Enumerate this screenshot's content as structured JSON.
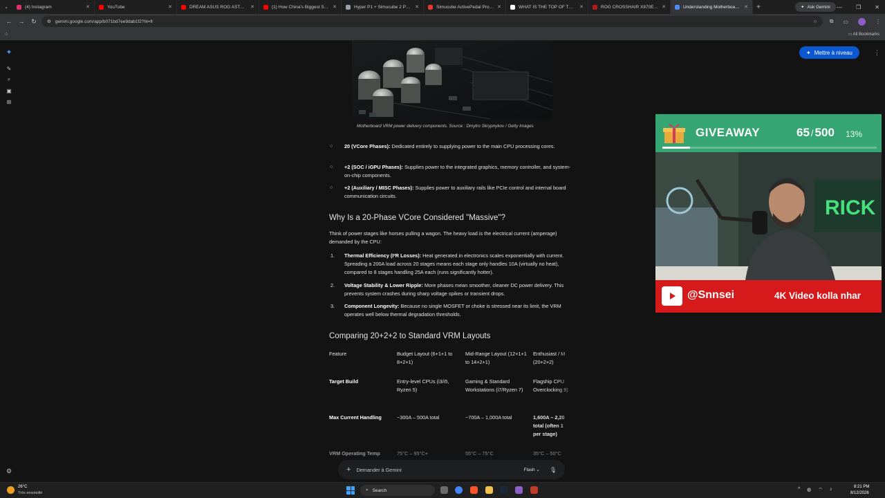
{
  "browser": {
    "tabs": [
      {
        "title": "(4) Instagram",
        "color": "#e1306c"
      },
      {
        "title": "YouTube",
        "color": "#ff0000"
      },
      {
        "title": "DREAM ASUS ROG ASTRAL RTX",
        "color": "#ff0000"
      },
      {
        "title": "(1) How China's Biggest Scam",
        "color": "#ff0000"
      },
      {
        "title": "Hyper P1 + Simucube 2 Pro Bu",
        "color": "#9aa0a6"
      },
      {
        "title": "Simucube ActivePedal Pro - Ad",
        "color": "#e23b2e"
      },
      {
        "title": "WHAT IS THE TOP OF THE LINE",
        "color": "#ffffff"
      },
      {
        "title": "ROG CROSSHAIR X870E GLACI",
        "color": "#b31b1b"
      },
      {
        "title": "Understanding Motherboard P",
        "color": "#4e8df5"
      }
    ],
    "active_tab_index": 8,
    "new_tab_label": "+",
    "ask_gemini": "Ask Gemini",
    "url": "gemini.google.com/app/b071bd7ee9dab1f2?hl=fr",
    "all_bookmarks": "All Bookmarks"
  },
  "gemini": {
    "upgrade_button": "Mettre à niveau",
    "caption": "Motherboard VRM power delivery components. Source : Dmytro Skrypnykov / Getty Images",
    "bullets": [
      {
        "title": "20 (VCore Phases):",
        "text": " Dedicated entirely to supplying power to the main CPU processing cores."
      },
      {
        "title": "+2 (SOC / iGPU Phases):",
        "text": " Supplies power to the integrated graphics, memory controller, and system-on-chip components."
      },
      {
        "title": "+2 (Auxiliary / MISC Phases):",
        "text": " Supplies power to auxiliary rails like PCIe control and internal board communication circuits."
      }
    ],
    "section1_heading": "Why Is a 20-Phase VCore Considered \"Massive\"?",
    "section1_intro": "Think of power stages like horses pulling a wagon. The heavy load is the electrical current (amperage) demanded by the CPU:",
    "numbered": [
      {
        "n": "1.",
        "title": "Thermal Efficiency (I²R Losses):",
        "text": " Heat generated in electronics scales exponentially with current. Spreading a 200A load across 20 stages means each stage only handles 10A (virtually no heat), compared to 8 stages handling 25A each (runs significantly hotter)."
      },
      {
        "n": "2.",
        "title": "Voltage Stability & Lower Ripple:",
        "text": " More phases mean smoother, cleaner DC power delivery. This prevents system crashes during sharp voltage spikes or transient drops."
      },
      {
        "n": "3.",
        "title": "Component Longevity:",
        "text": " Because no single MOSFET or choke is stressed near its limit, the VRM operates well below thermal degradation thresholds."
      }
    ],
    "section2_heading": "Comparing 20+2+2 to Standard VRM Layouts",
    "table": {
      "headers": [
        "Feature",
        "Budget Layout (6+1+1 to 8+2+1)",
        "Mid-Range Layout (12+1+1 to 14+2+1)",
        "Enthusiast / M (20+2+2)"
      ],
      "rows": [
        [
          "Target Build",
          "Entry-level CPUs (i3/i5, Ryzen 5)",
          "Gaming & Standard Workstations (i7/Ryzen 7)",
          "Flagship CPU Overclocking 9)"
        ],
        [
          "Max Current Handling",
          "~300A – 500A total",
          "~700A – 1,000A total",
          "1,600A – 2,20 total (often 1 per stage)"
        ],
        [
          "VRM Operating Temp",
          "75°C – 95°C+",
          "55°C – 75°C",
          "35°C – 50°C"
        ]
      ]
    },
    "prompt_placeholder": "Demander à Gemini",
    "prompt_model": "Flash"
  },
  "overlay": {
    "giveaway_label": "GIVEAWAY",
    "count": "65",
    "separator": "/",
    "total": "500",
    "percent_label": "13%",
    "progress_fraction": 0.13,
    "handle": "@Snnsei",
    "tagline": "4K Video kolla nhar",
    "accent_green": "#36a574",
    "accent_red": "#d6191b"
  },
  "taskbar": {
    "temperature": "26°C",
    "weather": "Très ensoleillé",
    "search_label": "Search",
    "time": "8:21 PM",
    "date": "8/12/2026"
  }
}
